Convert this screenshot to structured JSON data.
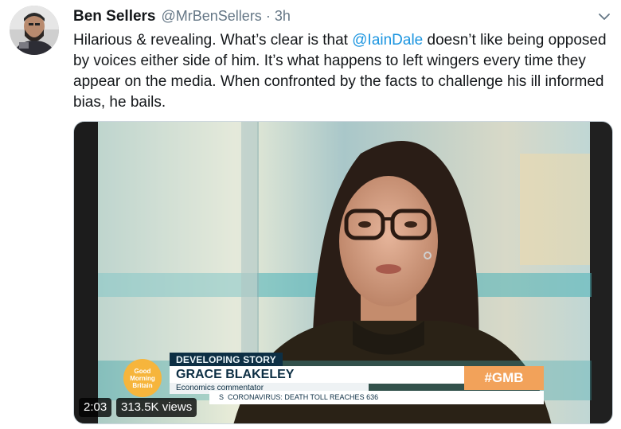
{
  "user": {
    "display_name": "Ben Sellers",
    "handle": "@MrBenSellers",
    "separator": "·",
    "time": "3h"
  },
  "tweet": {
    "text_before": "Hilarious & revealing. What’s clear is that ",
    "mention": "@IainDale",
    "text_after": " doesn’t like being opposed by voices either side of him. It’s what happens to left wingers every time they appear on the media. When confronted by the facts to challenge his ill informed bias, he bails."
  },
  "video": {
    "developing_story": "DEVELOPING STORY",
    "person_name": "GRACE BLAKELEY",
    "person_role": "Economics commentator",
    "hashtag": "#GMB",
    "logo_line1": "Good",
    "logo_line2": "Morning",
    "logo_line3": "Britain",
    "ticker_prefix": "S",
    "ticker": "CORONAVIRUS: DEATH TOLL REACHES 636",
    "duration": "2:03",
    "views": "313.5K views"
  },
  "colors": {
    "mention": "#1b95e0",
    "secondary_text": "#657786",
    "lower_third_navy": "#0d2f44",
    "hashtag_orange": "#f2a25a"
  },
  "icons": {
    "caret": "chevron-down-icon"
  }
}
